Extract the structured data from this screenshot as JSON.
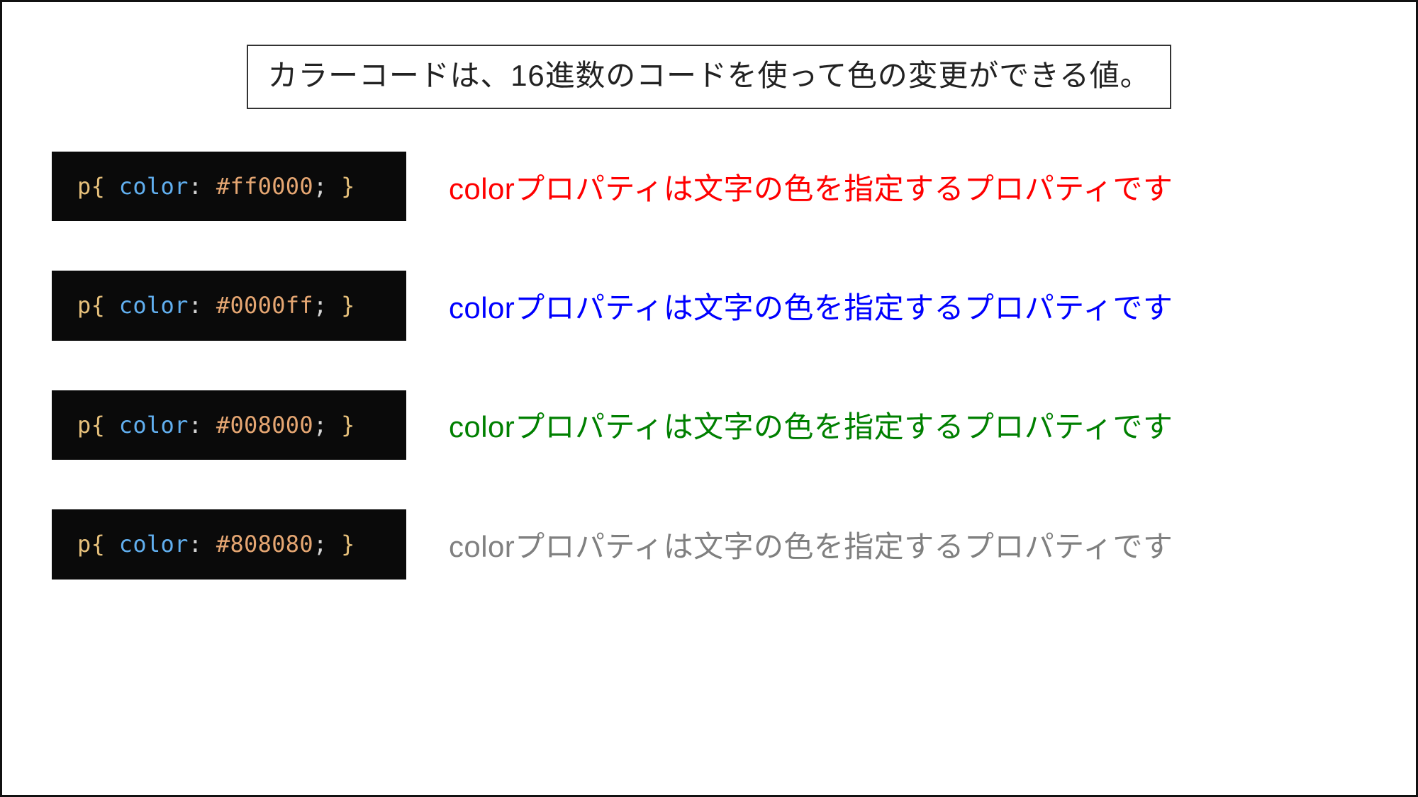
{
  "title": "カラーコードは、16進数のコードを使って色の変更ができる値。",
  "code_tokens": {
    "selector": "p",
    "brace_open": "{ ",
    "property": "color",
    "colon": ": ",
    "semi": ";",
    "brace_close": " }"
  },
  "sample_text": "colorプロパティは文字の色を指定するプロパティです",
  "examples": [
    {
      "hex": "#ff0000",
      "text_color": "#ff0000"
    },
    {
      "hex": "#0000ff",
      "text_color": "#0000ff"
    },
    {
      "hex": "#008000",
      "text_color": "#008000"
    },
    {
      "hex": "#808080",
      "text_color": "#808080"
    }
  ]
}
